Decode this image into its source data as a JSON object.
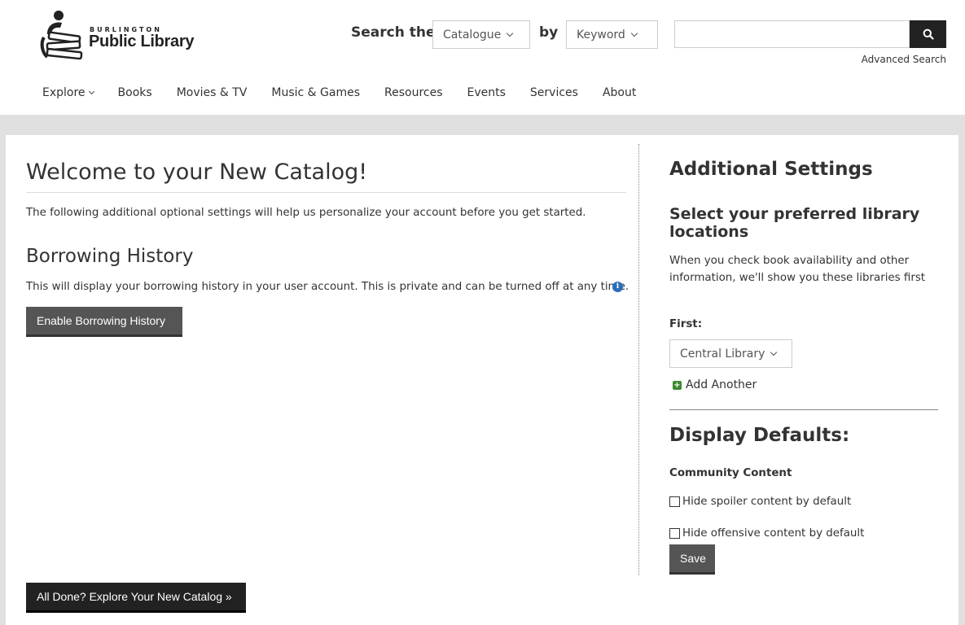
{
  "header": {
    "logo_small": "BURLINGTON",
    "logo_big": "Public Library",
    "search_label": "Search the",
    "search_scope": "Catalogue",
    "by_label": "by",
    "search_type": "Keyword",
    "search_value": "",
    "advanced_search": "Advanced Search"
  },
  "nav": {
    "items": [
      "Explore",
      "Books",
      "Movies & TV",
      "Music & Games",
      "Resources",
      "Events",
      "Services",
      "About"
    ]
  },
  "main": {
    "title": "Welcome to your New Catalog!",
    "intro": "The following additional optional settings will help us personalize your account before you get started.",
    "borrowing_history_title": "Borrowing History",
    "borrowing_history_text": "This will display your borrowing history in your user account. This is private and can be turned off at any time.",
    "enable_button": "Enable Borrowing History",
    "done_button": "All Done? Explore Your New Catalog »"
  },
  "sidebar": {
    "title": "Additional Settings",
    "pref_title": "Select your preferred library locations",
    "pref_desc": "When you check book availability and other information, we'll show you these libraries first",
    "first_label": "First:",
    "first_value": "Central Library",
    "add_another": "Add Another",
    "display_defaults_title": "Display Defaults:",
    "community_content_label": "Community Content",
    "hide_spoiler": "Hide spoiler content by default",
    "hide_offensive": "Hide offensive content by default",
    "save_button": "Save"
  },
  "colors": {
    "grey_band": "#e0e0e0",
    "dark_button": "#555555",
    "black_button": "#222222",
    "info_blue": "#2a6ebb",
    "add_green": "#3c8a2e"
  }
}
